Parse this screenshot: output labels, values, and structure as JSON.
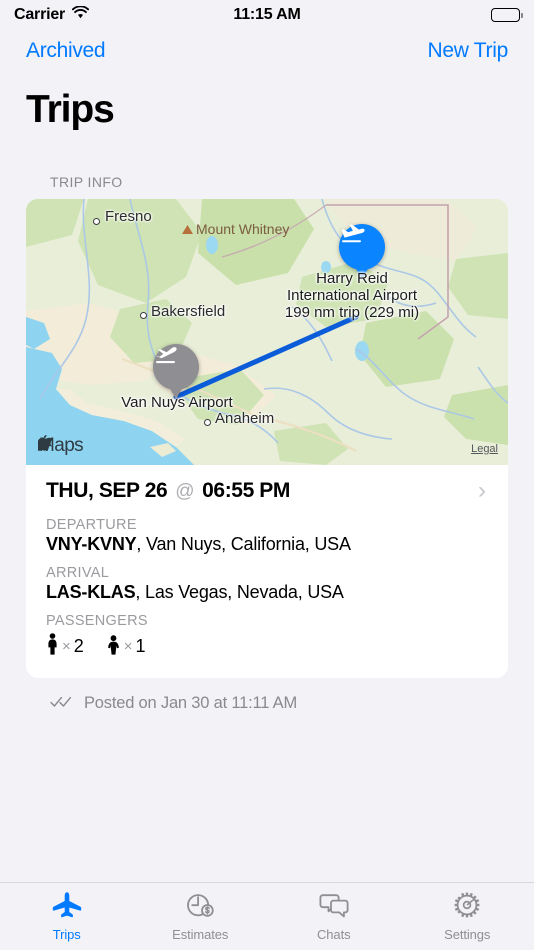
{
  "status_bar": {
    "carrier": "Carrier",
    "wifi_icon": "wifi-icon",
    "time": "11:15 AM",
    "battery_icon": "battery-full-icon"
  },
  "nav_bar": {
    "left_button": "Archived",
    "right_button": "New Trip"
  },
  "page_title": "Trips",
  "section_header": "TRIP INFO",
  "map": {
    "attribution": "Maps",
    "legal_link": "Legal",
    "cities": [
      {
        "name": "Fresno"
      },
      {
        "name": "Bakersfield"
      },
      {
        "name": "Anaheim"
      }
    ],
    "peak": "Mount Whitney",
    "departure_pin": {
      "icon": "airplane-takeoff-icon",
      "label": "Van Nuys Airport",
      "color": "#8e8e93"
    },
    "arrival_pin": {
      "icon": "airplane-landing-icon",
      "color": "#0a84ff",
      "label_line1": "Harry Reid",
      "label_line2": "International Airport",
      "label_line3": "199 nm trip (229 mi)"
    },
    "route_color": "#0a5cd8"
  },
  "trip": {
    "date": "THU, SEP 26",
    "at_symbol": "@",
    "time": "06:55 PM",
    "disclosure_icon": "chevron-right-icon",
    "departure_label": "DEPARTURE",
    "departure_code": "VNY-KVNY",
    "departure_place": ", Van Nuys, California, USA",
    "arrival_label": "ARRIVAL",
    "arrival_code": "LAS-KLAS",
    "arrival_place": ", Las Vegas, Nevada, USA",
    "passengers_label": "PASSENGERS",
    "passengers": [
      {
        "icon": "adult-passenger-icon",
        "x": "×",
        "count": "2"
      },
      {
        "icon": "child-passenger-icon",
        "x": "×",
        "count": "1"
      }
    ]
  },
  "posted": {
    "icon": "double-check-icon",
    "text": "Posted on Jan 30 at 11:11 AM"
  },
  "tab_bar": {
    "active_color": "#007aff",
    "inactive_color": "#8e8e93",
    "tabs": [
      {
        "label": "Trips",
        "icon": "airplane-icon"
      },
      {
        "label": "Estimates",
        "icon": "clock-dollar-icon"
      },
      {
        "label": "Chats",
        "icon": "chat-bubbles-icon"
      },
      {
        "label": "Settings",
        "icon": "gear-icon"
      }
    ]
  }
}
